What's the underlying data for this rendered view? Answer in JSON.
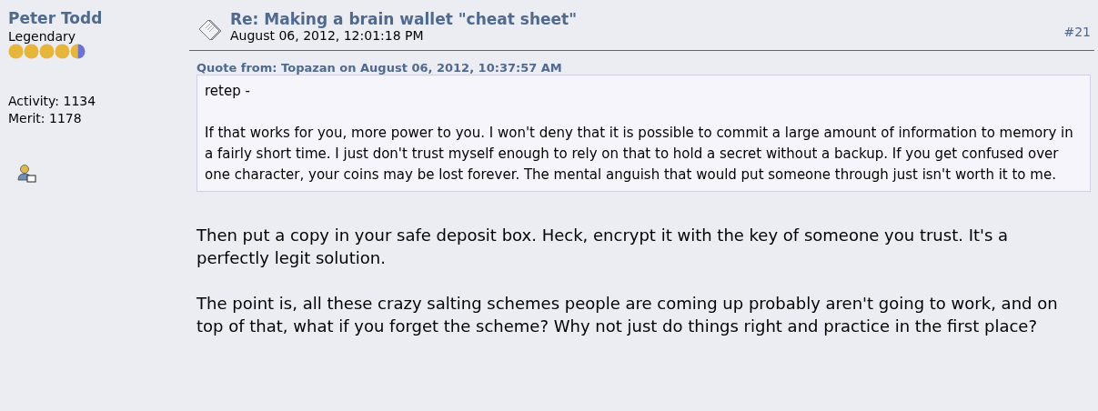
{
  "author": {
    "name": "Peter Todd",
    "rank": "Legendary",
    "stars": 4.5,
    "activity": "Activity: 1134",
    "merit": "Merit: 1178"
  },
  "post": {
    "title": "Re: Making a brain wallet \"cheat sheet\"",
    "date": "August 06, 2012, 12:01:18 PM",
    "number": "#21",
    "quote": {
      "header": "Quote from: Topazan on August 06, 2012, 10:37:57 AM",
      "paragraphs": [
        "retep -",
        "If that works for you, more power to you.  I won't deny that it is possible to commit a large amount of information to memory in a fairly short time.  I just don't trust myself enough to rely on that to hold a secret without a backup.  If you get confused over one character, your coins may be lost forever.  The mental anguish that would put someone through just isn't worth it to me."
      ]
    },
    "paragraphs": [
      "Then put a copy in your safe deposit box. Heck, encrypt it with the key of someone you trust. It's a perfectly legit solution.",
      "The point is, all these crazy salting schemes people are coming up probably aren't going to work, and on top of that, what if you forget the scheme? Why not just do things right and practice in the first place?"
    ]
  }
}
